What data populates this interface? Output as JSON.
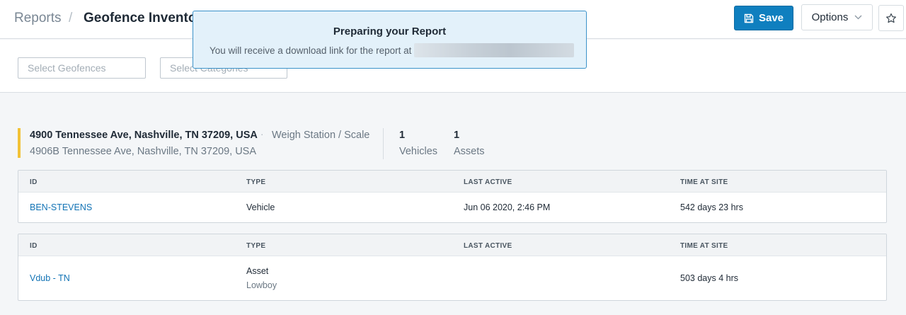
{
  "header": {
    "breadcrumb_root": "Reports",
    "breadcrumb_sep": "/",
    "title": "Geofence Inventory",
    "save_label": "Save",
    "options_label": "Options"
  },
  "toast": {
    "title": "Preparing your Report",
    "message": "You will receive a download link for the report at"
  },
  "filters": {
    "geofences_placeholder": "Select Geofences",
    "categories_placeholder": "Select Categories"
  },
  "geofence": {
    "address": "4900 Tennessee Ave, Nashville, TN 37209, USA",
    "separator": "·",
    "type": "Weigh Station / Scale",
    "sub_address": "4906B Tennessee Ave, Nashville, TN 37209, USA",
    "vehicles_count": "1",
    "vehicles_label": "Vehicles",
    "assets_count": "1",
    "assets_label": "Assets"
  },
  "tables": [
    {
      "columns": [
        "ID",
        "TYPE",
        "LAST ACTIVE",
        "TIME AT SITE"
      ],
      "row": {
        "id": "BEN-STEVENS",
        "type": "Vehicle",
        "type_sub": "",
        "last_active": "Jun 06 2020, 2:46 PM",
        "time_at_site": "542 days 23 hrs"
      }
    },
    {
      "columns": [
        "ID",
        "TYPE",
        "LAST ACTIVE",
        "TIME AT SITE"
      ],
      "row": {
        "id": "Vdub - TN",
        "type": "Asset",
        "type_sub": "Lowboy",
        "last_active": "",
        "time_at_site": "503 days 4 hrs"
      }
    }
  ],
  "colors": {
    "primary": "#0f7fbf",
    "link": "#1273b5",
    "accent": "#f2c237",
    "toast_bg": "#e3f1fa",
    "toast_border": "#3b92c9"
  },
  "icons": {
    "save": "floppy-disk-icon",
    "options": "chevron-down-icon",
    "favorite": "star-icon"
  }
}
